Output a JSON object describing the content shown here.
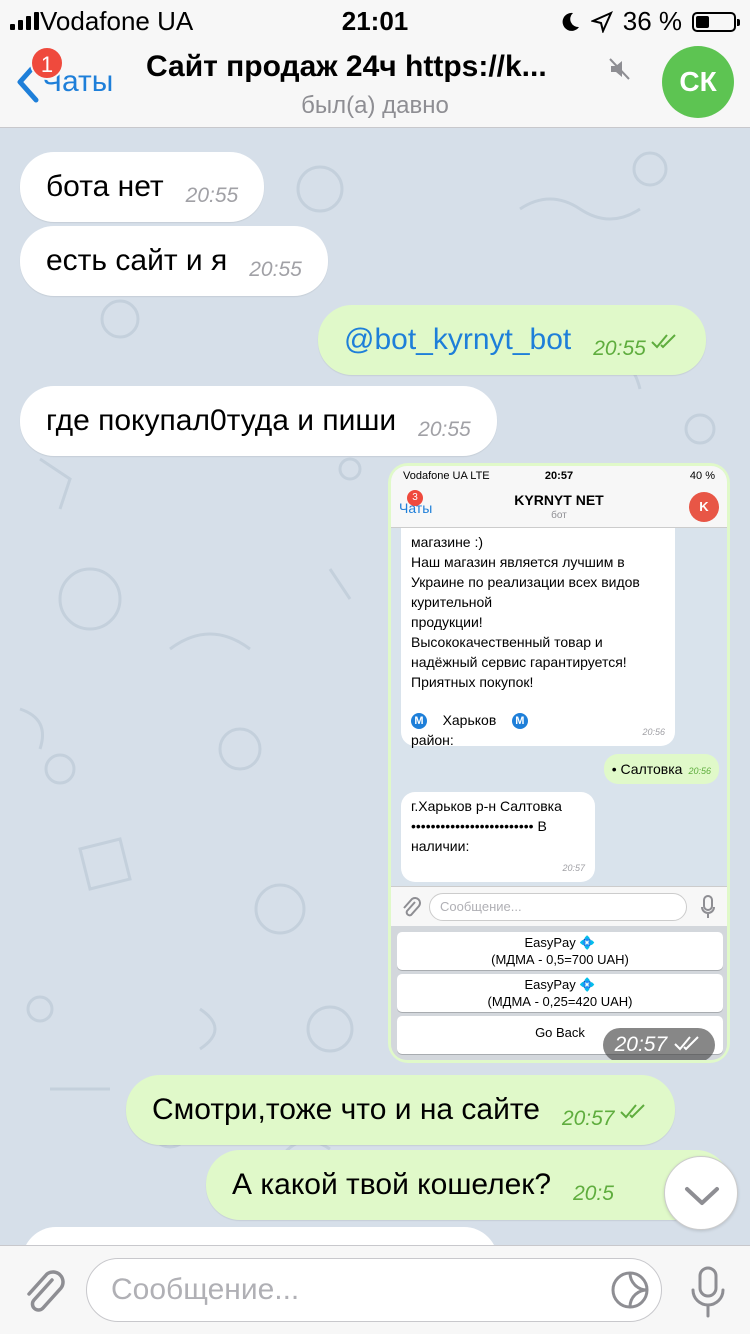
{
  "status_bar": {
    "carrier": "Vodafone UA",
    "time": "21:01",
    "battery": "36 %",
    "battery_level": 0.36
  },
  "header": {
    "back_label": "Чаты",
    "unread_count": "1",
    "title": "Сайт продаж 24ч https://k...",
    "subtitle": "был(а) давно",
    "avatar_initials": "СК",
    "avatar_color": "#5dc452"
  },
  "messages": [
    {
      "dir": "in",
      "text": "бота нет",
      "time": "20:55"
    },
    {
      "dir": "in",
      "text": "есть сайт и я",
      "time": "20:55"
    },
    {
      "dir": "out",
      "text": "@bot_kyrnyt_bot",
      "time": "20:55"
    },
    {
      "dir": "in",
      "text": "где покупал0туда и пиши",
      "time": "20:55"
    },
    {
      "dir": "out",
      "text": "Смотри,тоже что и на сайте",
      "time": "20:57"
    },
    {
      "dir": "out",
      "text": "А какой твой кошелек?",
      "time": "20:5"
    }
  ],
  "photo": {
    "time": "20:57",
    "status_carrier": "Vodafone UA  LTE",
    "status_time": "20:57",
    "status_battery": "40 %",
    "back_label": "Чаты",
    "unread": "3",
    "title": "KYRNYT NET",
    "subtitle": "бот",
    "avatar": "K",
    "msg_lines": [
      "магазине :)",
      "Наш магазин является лучшим в",
      "Украине по реализации всех видов",
      "курительной",
      "продукции!",
      "Высококачественный товар и",
      "надёжный сервис гарантируется!",
      "Приятных покупок!"
    ],
    "metro_city": "Харьков",
    "district": "район:",
    "msg_time": "20:56",
    "reply": "• Салтовка",
    "reply_time": "20:56",
    "msg2_lines": [
      "г.Харьков",
      "р-н Салтовка",
      "•••••••••••••••••••••••••",
      "В наличии:"
    ],
    "msg2_time": "20:57",
    "input_placeholder": "Сообщение...",
    "buttons": [
      {
        "line1": "EasyPay 💠",
        "line2": "(МДМА - 0,5=700 UAH)"
      },
      {
        "line1": "EasyPay 💠",
        "line2": "(МДМА - 0,25=420 UAH)"
      },
      {
        "line1": "Go Back",
        "line2": ""
      }
    ]
  },
  "input": {
    "placeholder": "Сообщение..."
  },
  "colors": {
    "accent": "#1e7fd9",
    "outgoing": "#e0f9c9",
    "badge": "#ef4a3d"
  }
}
